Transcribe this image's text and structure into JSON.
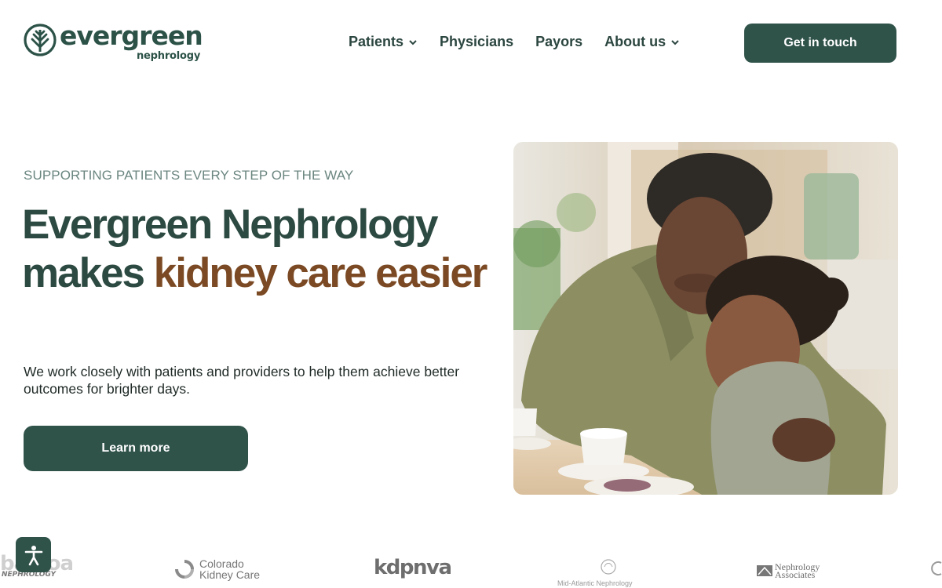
{
  "header": {
    "logo": {
      "word": "evergreen",
      "sub": "nephrology"
    },
    "nav": [
      {
        "label": "Patients",
        "has_dropdown": true
      },
      {
        "label": "Physicians",
        "has_dropdown": false
      },
      {
        "label": "Payors",
        "has_dropdown": false
      },
      {
        "label": "About us",
        "has_dropdown": true
      }
    ],
    "cta_label": "Get in touch"
  },
  "hero": {
    "eyebrow": "SUPPORTING PATIENTS EVERY STEP OF THE WAY",
    "headline_part1": "Evergreen Nephrology makes ",
    "headline_part2": "kidney care easier",
    "lead": "We work closely with patients and providers to help them achieve better outcomes for brighter days.",
    "button_label": "Learn more"
  },
  "partners": [
    {
      "name": "balboa",
      "sub": "NEPHROLOGY"
    },
    {
      "name": "Colorado Kidney Care"
    },
    {
      "name": "kdpnva"
    },
    {
      "name": "Mid-Atlantic Nephrology Associates, P.A."
    },
    {
      "name": "Nephrology Associates"
    }
  ],
  "colors": {
    "brand": "#2f5249",
    "accent": "#7b4a24",
    "eyebrow": "#6b8680"
  },
  "icons": [
    "evergreen-tree-icon",
    "chevron-down-icon",
    "accessibility-icon"
  ]
}
